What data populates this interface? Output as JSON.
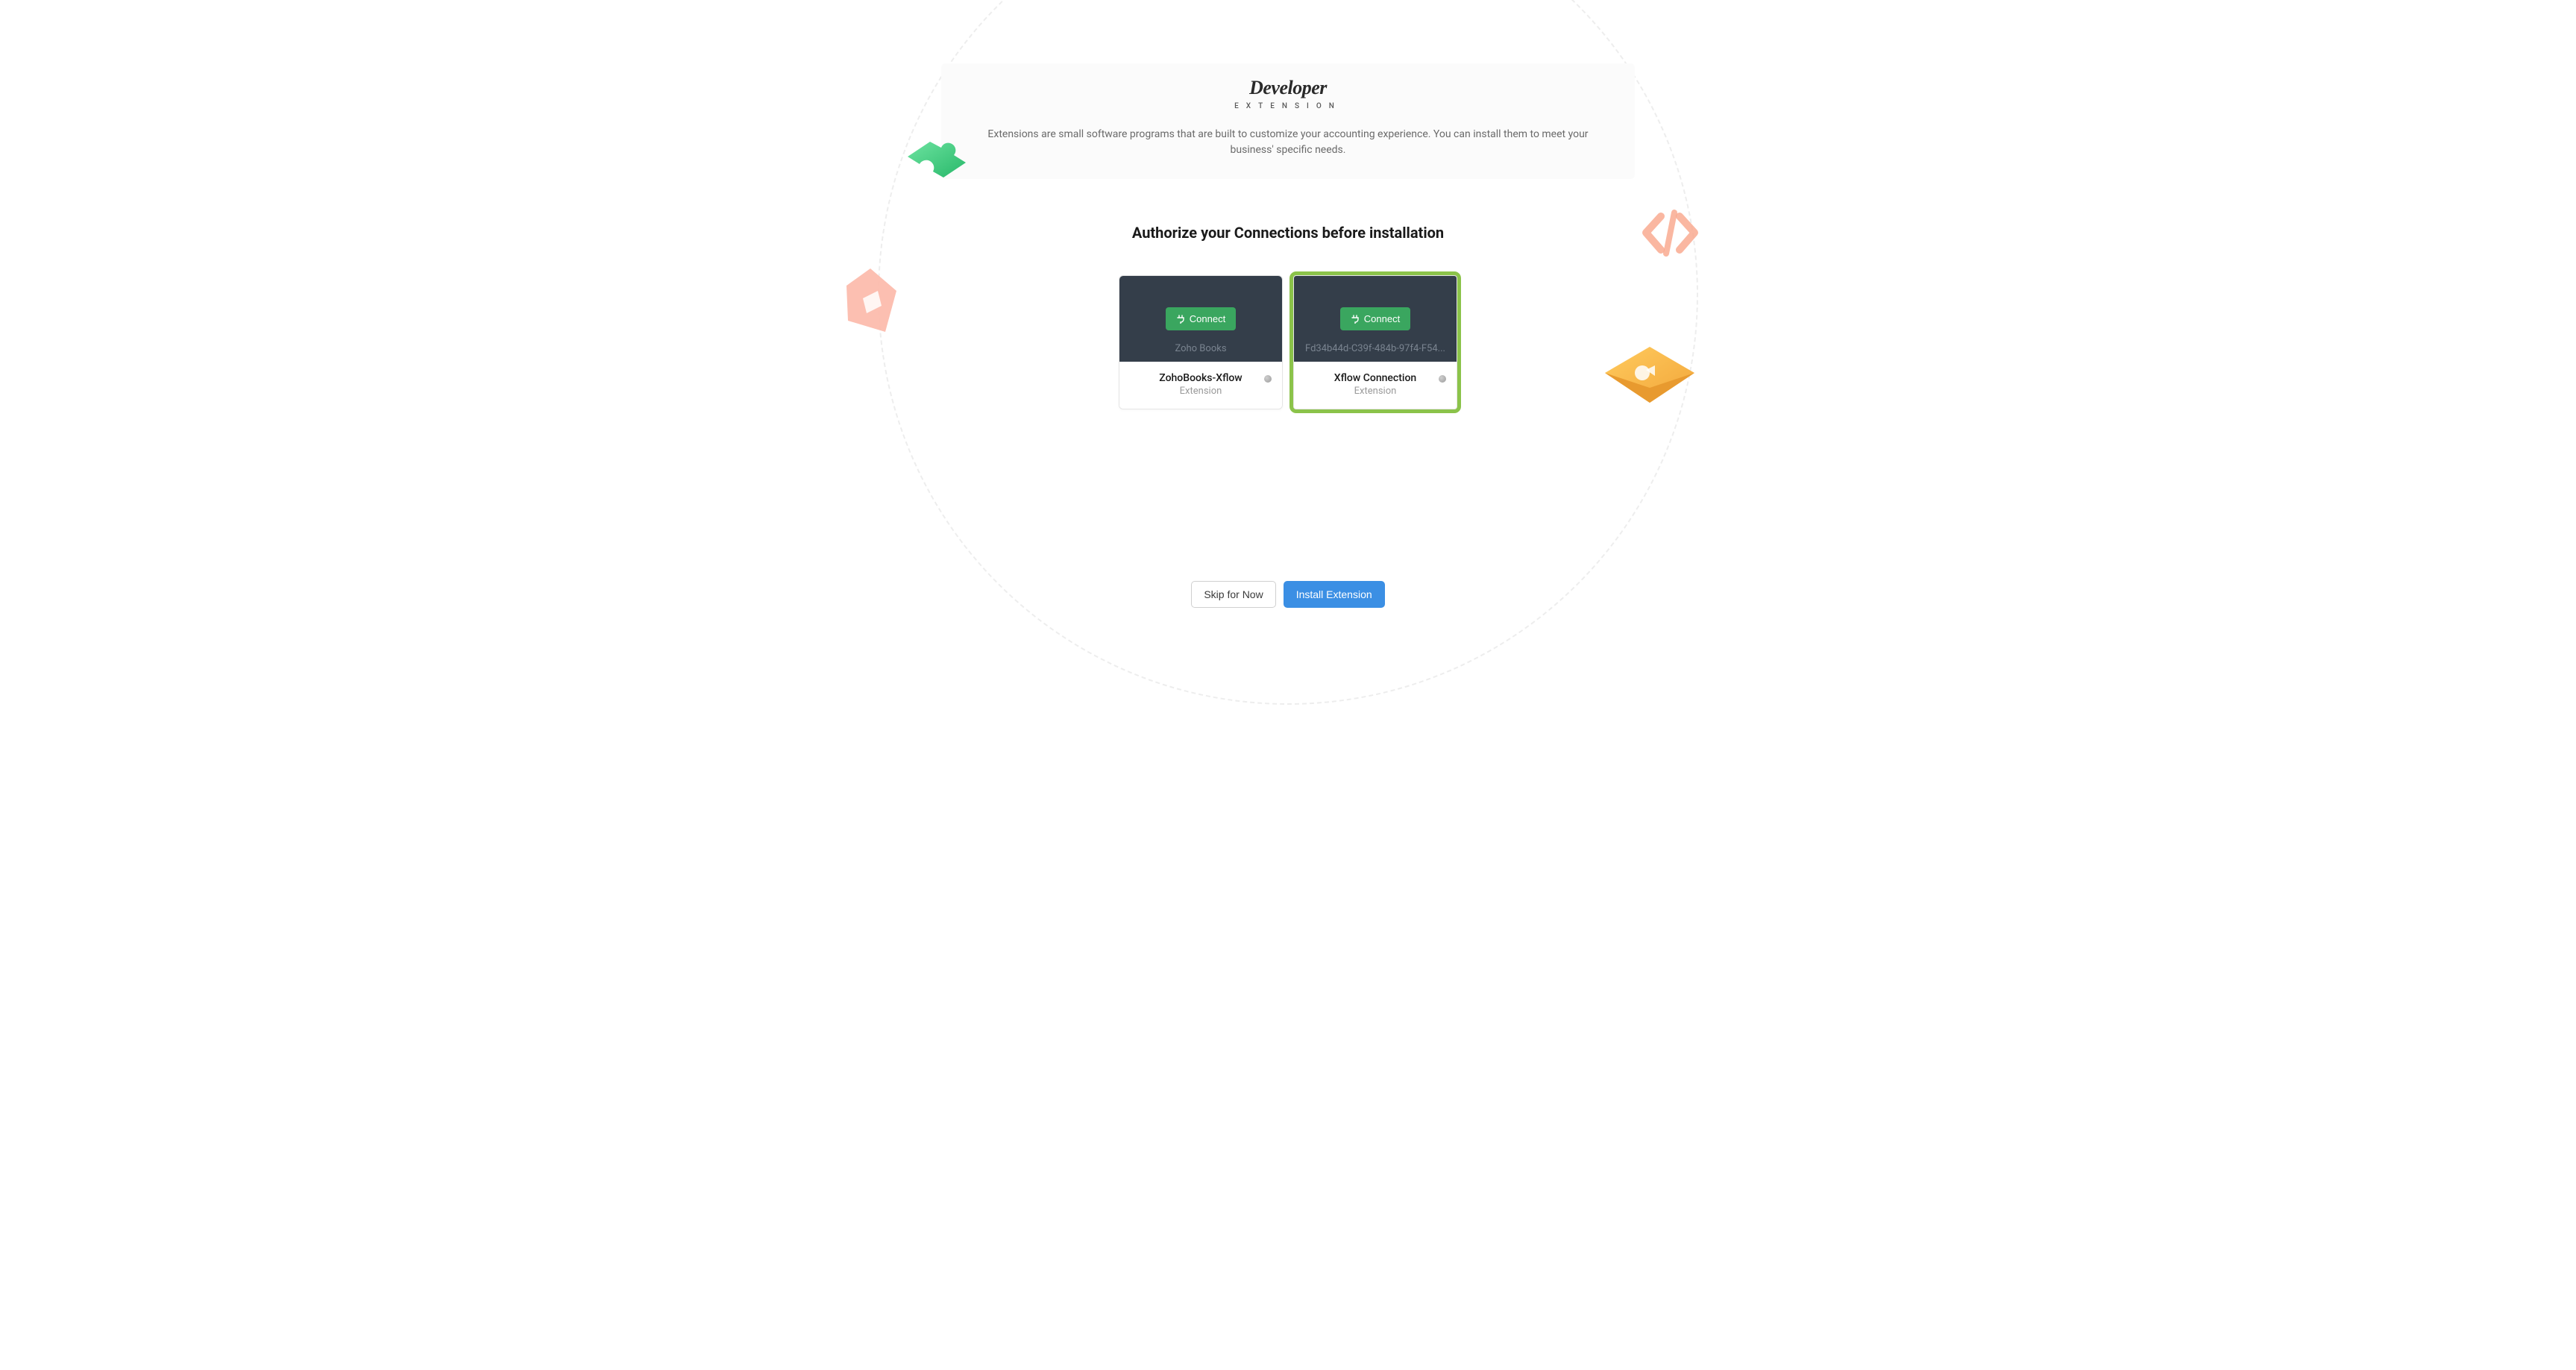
{
  "brand": {
    "title": "Developer",
    "subtitle": "EXTENSION"
  },
  "header": {
    "description": "Extensions are small software programs that are built to customize your accounting experience. You can install them to meet your business' specific needs."
  },
  "section": {
    "title": "Authorize your Connections before installation"
  },
  "connections": [
    {
      "connect_label": "Connect",
      "placeholder": "Zoho Books",
      "name": "ZohoBooks-Xflow",
      "subtitle": "Extension",
      "highlighted": false
    },
    {
      "connect_label": "Connect",
      "placeholder": "Fd34b44d-C39f-484b-97f4-F54...",
      "name": "Xflow Connection",
      "subtitle": "Extension",
      "highlighted": true
    }
  ],
  "footer": {
    "skip_label": "Skip for Now",
    "install_label": "Install Extension"
  }
}
